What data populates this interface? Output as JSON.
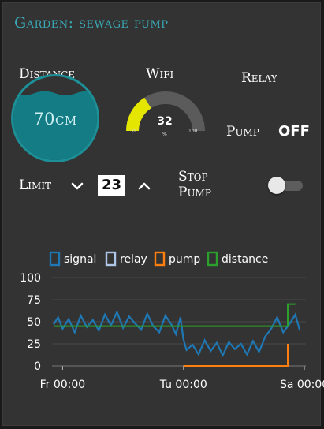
{
  "title": "Garden: sewage pump",
  "distance": {
    "label": "Distance",
    "value": "70cm",
    "level_fraction": 0.8
  },
  "wifi": {
    "label": "Wifi",
    "value": "32",
    "unit": "%",
    "min": "0",
    "max": "100",
    "fraction": 0.32
  },
  "relay": {
    "label": "Relay"
  },
  "pump": {
    "label": "Pump",
    "state": "OFF"
  },
  "limit": {
    "label": "Limit",
    "value": "23"
  },
  "stop_pump": {
    "label_line1": "Stop",
    "label_line2": "Pump",
    "on": false
  },
  "colors": {
    "title": "#3aaab7",
    "gauge": "#e4e600",
    "signal": "#1f77b4",
    "relay": "#aec7e8",
    "pump": "#ff7f0e",
    "distance": "#2ca02c"
  },
  "chart_data": {
    "type": "line",
    "ylim": [
      0,
      100
    ],
    "yticks": [
      "0",
      "25",
      "50",
      "75",
      "100"
    ],
    "xticks": [
      "Fr 00:00",
      "Tu 00:00",
      "Sa 00:00"
    ],
    "xlim": [
      -0.35,
      8.05
    ],
    "xtick_positions": [
      0,
      4,
      8
    ],
    "legend": [
      "signal",
      "relay",
      "pump",
      "distance"
    ],
    "series": [
      {
        "name": "signal",
        "x": [
          -0.3,
          -0.15,
          0,
          0.2,
          0.4,
          0.6,
          0.8,
          1.0,
          1.2,
          1.4,
          1.6,
          1.8,
          2.0,
          2.2,
          2.4,
          2.6,
          2.8,
          3.0,
          3.2,
          3.4,
          3.6,
          3.75,
          3.9,
          4.0,
          4.1,
          4.3,
          4.5,
          4.7,
          4.9,
          5.1,
          5.3,
          5.5,
          5.7,
          5.9,
          6.1,
          6.3,
          6.5,
          6.6,
          6.7,
          6.9,
          7.1,
          7.3,
          7.5,
          7.7,
          7.85
        ],
        "y": [
          47,
          55,
          42,
          53,
          38,
          57,
          44,
          52,
          40,
          58,
          46,
          61,
          43,
          56,
          48,
          41,
          59,
          45,
          38,
          57,
          47,
          36,
          55,
          30,
          18,
          24,
          13,
          29,
          17,
          26,
          12,
          27,
          19,
          25,
          13,
          28,
          16,
          24,
          33,
          42,
          55,
          38,
          47,
          58,
          40
        ]
      },
      {
        "name": "relay",
        "x": [
          4.0,
          5.0
        ],
        "y": [
          0,
          0
        ]
      },
      {
        "name": "pump",
        "x": [
          4.0,
          7.45,
          7.45
        ],
        "y": [
          0,
          0,
          25
        ]
      },
      {
        "name": "distance",
        "x": [
          -0.3,
          3.85,
          3.85,
          7.45,
          7.45,
          7.7
        ],
        "y": [
          45,
          45,
          45,
          45,
          70,
          70
        ]
      }
    ]
  }
}
